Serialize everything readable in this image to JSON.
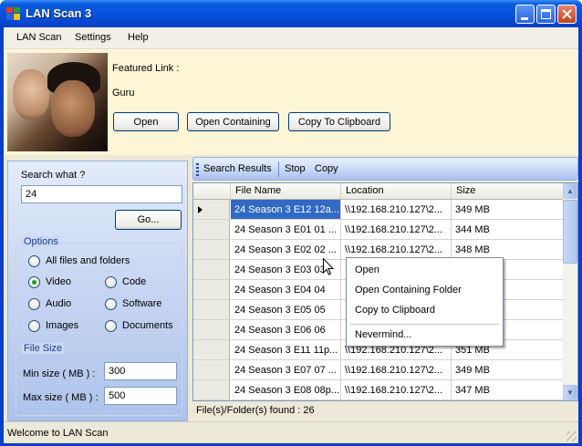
{
  "window": {
    "title": "LAN Scan 3"
  },
  "menu": [
    "LAN Scan",
    "Settings",
    "Help"
  ],
  "featured": {
    "label": "Featured Link :",
    "name": "Guru",
    "open": "Open",
    "open_containing": "Open Containing",
    "copy": "Copy To Clipboard"
  },
  "search": {
    "label": "Search what ?",
    "value": "24",
    "go": "Go..."
  },
  "options": {
    "title": "Options",
    "all": "All files and folders",
    "video": "Video",
    "code": "Code",
    "audio": "Audio",
    "software": "Software",
    "images": "Images",
    "documents": "Documents",
    "selected": "Video"
  },
  "filesize": {
    "title": "File Size",
    "min_label": "Min size ( MB ) :",
    "min_value": "300",
    "max_label": "Max size ( MB ) :",
    "max_value": "500"
  },
  "toolbar": {
    "search_results": "Search Results",
    "stop": "Stop",
    "copy": "Copy"
  },
  "grid": {
    "columns": [
      "File Name",
      "Location",
      "Size"
    ],
    "rows": [
      [
        "24 Season 3 E12 12a...",
        "\\\\192.168.210.127\\2...",
        "349 MB"
      ],
      [
        "24 Season 3 E01 01 ...",
        "\\\\192.168.210.127\\2...",
        "344 MB"
      ],
      [
        "24 Season 3 E02 02 ...",
        "\\\\192.168.210.127\\2...",
        "348 MB"
      ],
      [
        "24 Season 3 E03 03",
        "",
        ""
      ],
      [
        "24 Season 3 E04 04",
        "",
        ""
      ],
      [
        "24 Season 3 E05 05",
        "",
        ""
      ],
      [
        "24 Season 3 E06 06",
        "",
        ""
      ],
      [
        "24 Season 3 E11 11p...",
        "\\\\192.168.210.127\\2...",
        "351 MB"
      ],
      [
        "24 Season 3 E07 07 ...",
        "\\\\192.168.210.127\\2...",
        "349 MB"
      ],
      [
        "24 Season 3 E08 08p...",
        "\\\\192.168.210.127\\2...",
        "347 MB"
      ]
    ],
    "found": "File(s)/Folder(s) found : 26"
  },
  "context_menu": [
    "Open",
    "Open Containing Folder",
    "Copy to Clipboard",
    "Nevermind..."
  ],
  "status": "Welcome to LAN Scan"
}
